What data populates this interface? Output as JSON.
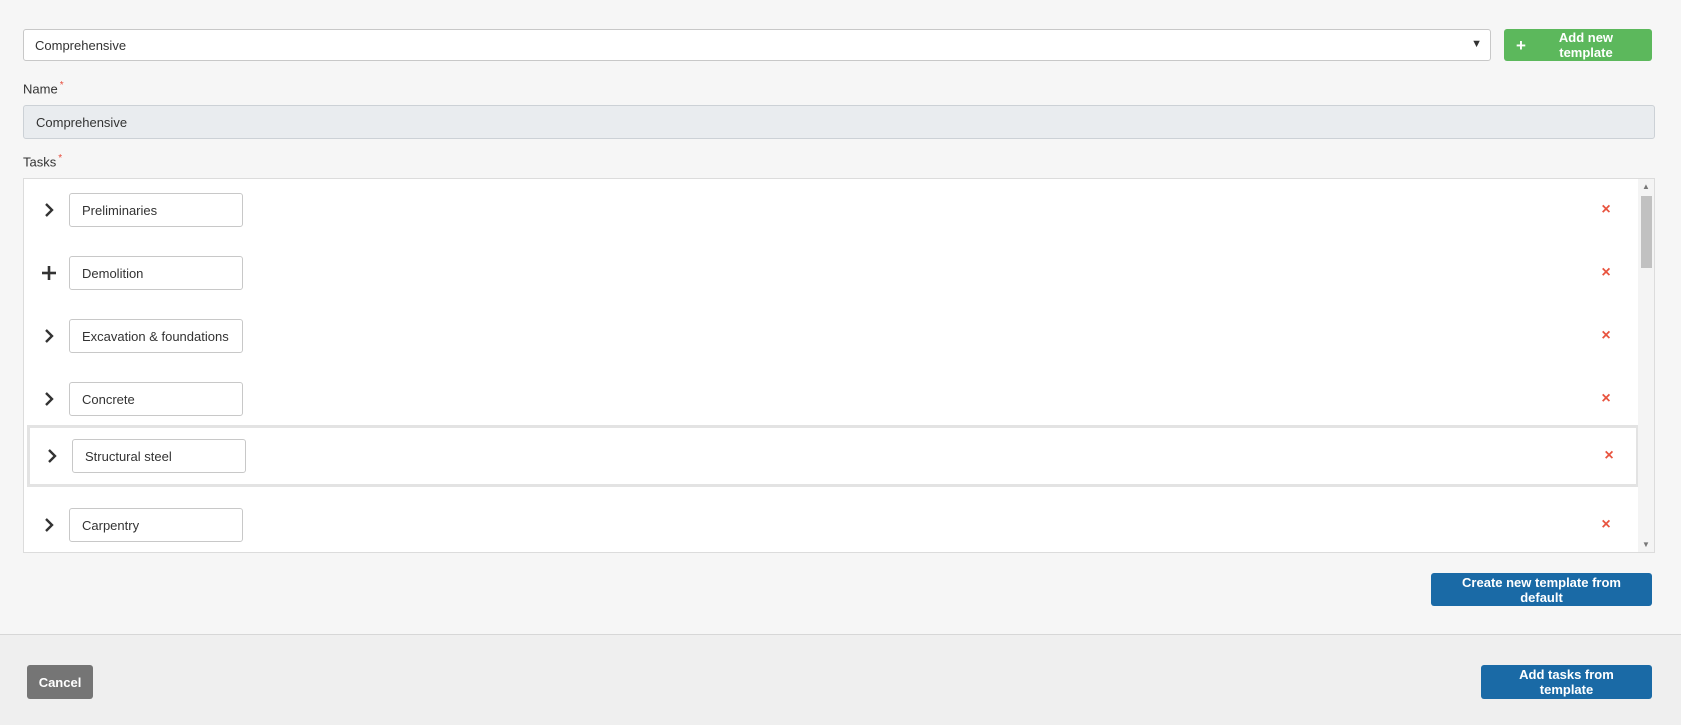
{
  "template_select": {
    "value": "Comprehensive",
    "caret": "▼"
  },
  "add_template_button": {
    "icon": "+",
    "label": "Add new template"
  },
  "name_field": {
    "label": "Name",
    "required_mark": "*",
    "value": "Comprehensive"
  },
  "tasks_field": {
    "label": "Tasks",
    "required_mark": "*",
    "items": [
      {
        "name": "Preliminaries",
        "toggle_icon": "chevron-right-icon"
      },
      {
        "name": "Demolition",
        "toggle_icon": "plus-icon"
      },
      {
        "name": "Excavation & foundations",
        "toggle_icon": "chevron-right-icon"
      },
      {
        "name": "Concrete",
        "toggle_icon": "chevron-right-icon"
      },
      {
        "name": "Structural steel",
        "toggle_icon": "chevron-right-icon"
      },
      {
        "name": "Carpentry",
        "toggle_icon": "chevron-right-icon"
      }
    ],
    "remove_icon": "×",
    "scroll_up": "▲",
    "scroll_down": "▼"
  },
  "create_from_default_button": {
    "label": "Create new template from default"
  },
  "cancel_button": {
    "label": "Cancel"
  },
  "add_tasks_button": {
    "label": "Add tasks from template"
  },
  "colors": {
    "green": "#5cb85c",
    "blue": "#1a6aa6",
    "grey_button": "#757575",
    "remove": "#e8543f"
  }
}
